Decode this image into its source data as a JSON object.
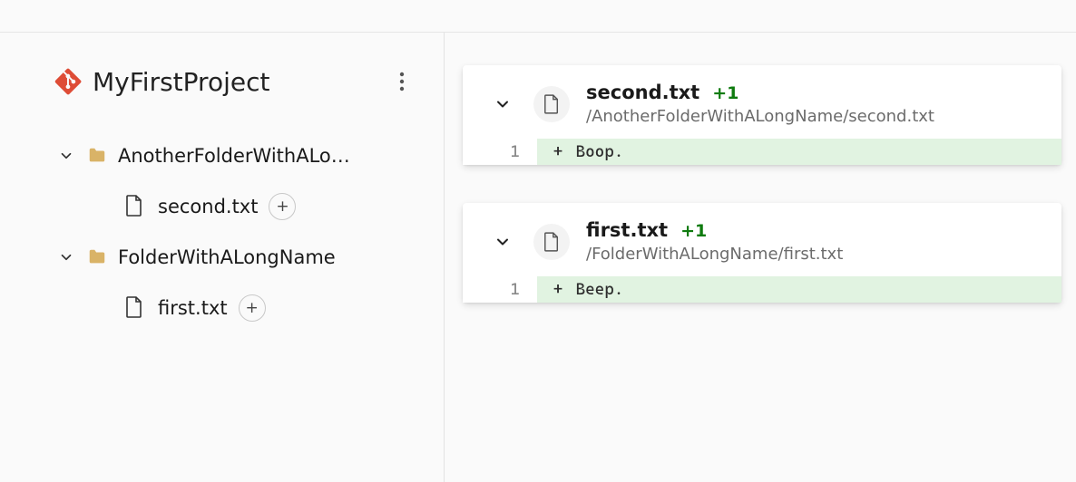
{
  "project": {
    "title": "MyFirstProject"
  },
  "tree": {
    "folders": [
      {
        "name": "AnotherFolderWithALo…",
        "files": [
          {
            "name": "second.txt",
            "badge": "+"
          }
        ]
      },
      {
        "name": "FolderWithALongName",
        "files": [
          {
            "name": "first.txt",
            "badge": "+"
          }
        ]
      }
    ]
  },
  "diffs": [
    {
      "filename": "second.txt",
      "delta": "+1",
      "path": "/AnotherFolderWithALongName/second.txt",
      "lines": [
        {
          "num": "1",
          "sign": "+",
          "text": "Boop."
        }
      ]
    },
    {
      "filename": "first.txt",
      "delta": "+1",
      "path": "/FolderWithALongName/first.txt",
      "lines": [
        {
          "num": "1",
          "sign": "+",
          "text": "Beep."
        }
      ]
    }
  ]
}
